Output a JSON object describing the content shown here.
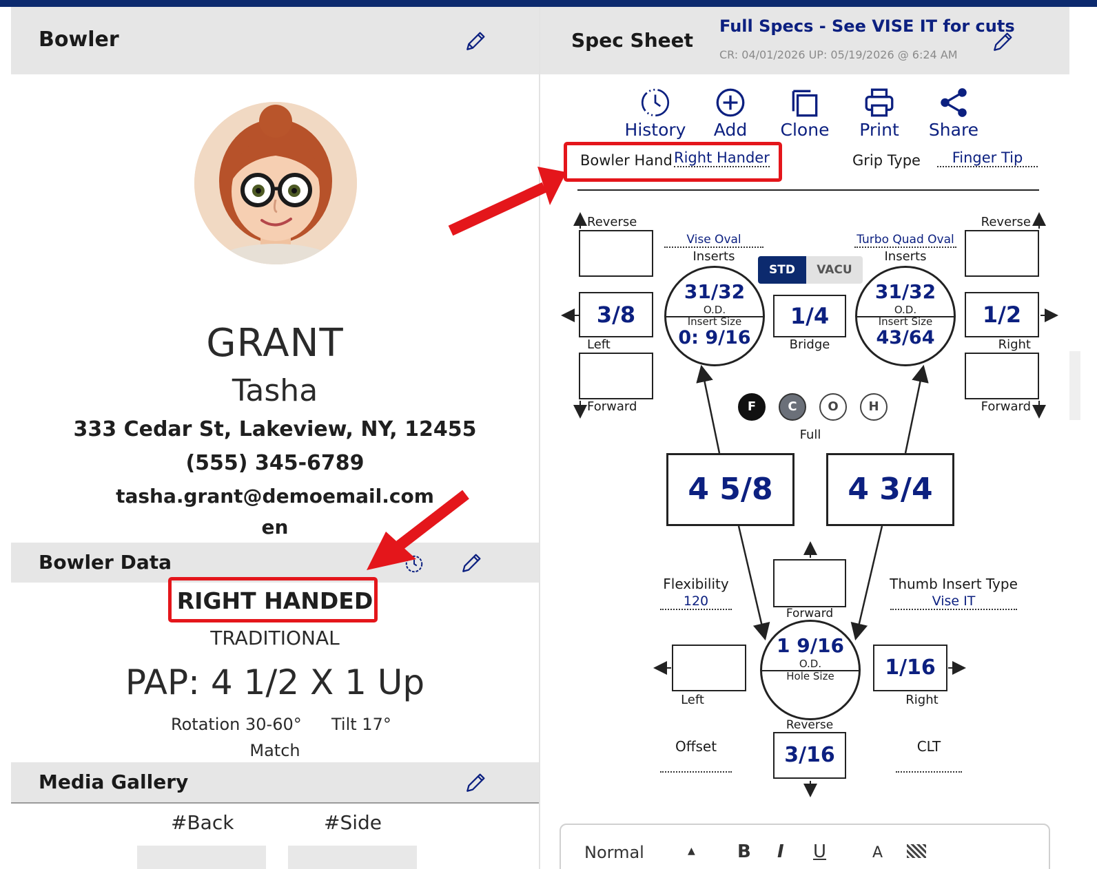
{
  "bowler_panel": {
    "title": "Bowler",
    "last_name": "GRANT",
    "first_name": "Tasha",
    "address": "333 Cedar St, Lakeview, NY, 12455",
    "phone": "(555) 345-6789",
    "email": "tasha.grant@demoemail.com",
    "language": "en"
  },
  "bowler_data": {
    "title": "Bowler Data",
    "hand": "RIGHT HANDED",
    "style": "TRADITIONAL",
    "pap": "PAP: 4 1/2 X 1 Up",
    "rotation": "Rotation 30-60°",
    "tilt": "Tilt 17°",
    "match": "Match"
  },
  "media_gallery": {
    "title": "Media Gallery",
    "tags": [
      "#Back",
      "#Side"
    ]
  },
  "spec_sheet": {
    "title": "Spec Sheet",
    "subtitle": "Full Specs - See VISE IT for cuts",
    "dates": "CR: 04/01/2026 UP: 05/19/2026 @ 6:24 AM",
    "toolbar": {
      "history": "History",
      "add": "Add",
      "clone": "Clone",
      "print": "Print",
      "share": "Share"
    },
    "bowler_hand_label": "Bowler Hand",
    "bowler_hand_value": "Right Hander",
    "grip_type_label": "Grip Type",
    "grip_type_value": "Finger Tip",
    "left_finger": {
      "insert_brand": "Vise Oval",
      "inserts_label": "Inserts",
      "od": "31/32",
      "od_label": "O.D.",
      "insert_size_label": "Insert Size",
      "insert_size": "0: 9/16",
      "pitch": "3/8",
      "pitch_label": "Left",
      "reverse_label": "Reverse",
      "forward_label": "Forward",
      "span": "4 5/8"
    },
    "right_finger": {
      "insert_brand": "Turbo Quad Oval",
      "inserts_label": "Inserts",
      "od": "31/32",
      "od_label": "O.D.",
      "insert_size_label": "Insert Size",
      "insert_size": "43/64",
      "pitch": "1/2",
      "pitch_label": "Right",
      "reverse_label": "Reverse",
      "forward_label": "Forward",
      "span": "4 3/4"
    },
    "toggle": {
      "std": "STD",
      "vacu": "VACU"
    },
    "bridge": {
      "value": "1/4",
      "label": "Bridge"
    },
    "fit_buttons": [
      "F",
      "C",
      "O",
      "H"
    ],
    "fit_selected": "Full",
    "flexibility_label": "Flexibility",
    "flexibility_value": "120",
    "thumb_insert_type_label": "Thumb Insert Type",
    "thumb_insert_type_value": "Vise IT",
    "thumb": {
      "od": "1 9/16",
      "od_label": "O.D.",
      "hole_size_label": "Hole Size",
      "forward_label": "Forward",
      "left_label": "Left",
      "right_value": "1/16",
      "right_label": "Right",
      "reverse_label": "Reverse",
      "reverse_value": "3/16"
    },
    "offset_label": "Offset",
    "clt_label": "CLT",
    "editor": {
      "format": "Normal",
      "bold": "B",
      "italic": "I",
      "underline": "U",
      "color": "A"
    }
  },
  "colors": {
    "accent_navy": "#0c2a6e",
    "link_blue": "#0c2080",
    "highlight_red": "#e4161b",
    "header_gray": "#e6e6e6"
  }
}
